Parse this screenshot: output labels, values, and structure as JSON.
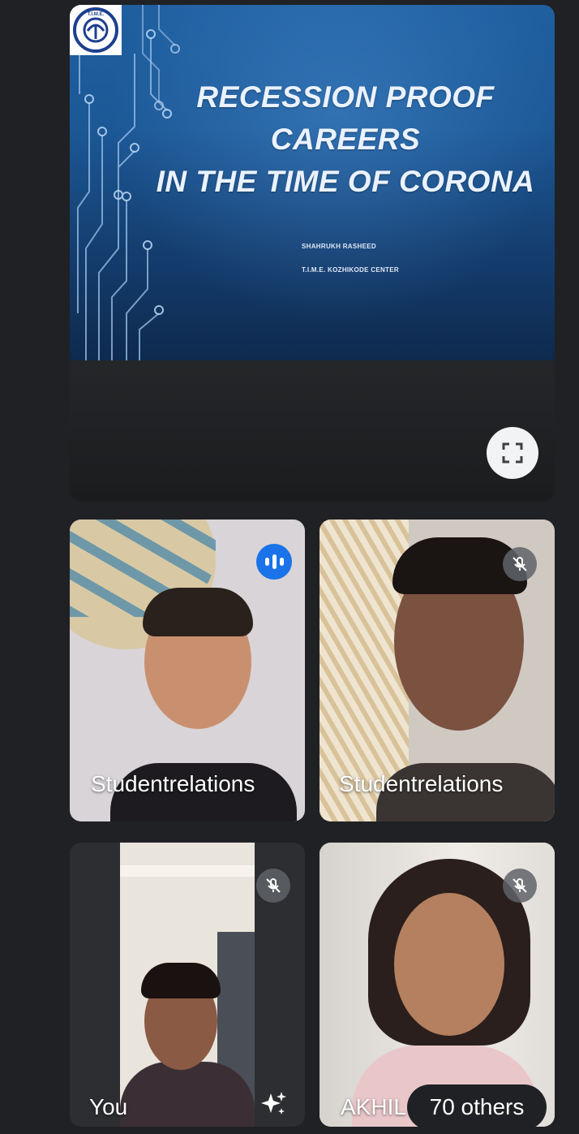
{
  "presentation": {
    "title": "RECESSION PROOF CAREERS IN THE TIME OF CORONA",
    "title_line1": "RECESSION PROOF CAREERS",
    "title_line2": "IN THE TIME OF CORONA",
    "presenter": "SHAHRUKH RASHEED",
    "center": "T.I.M.E. KOZHIKODE CENTER",
    "logo_text": "T.I.M.E.",
    "fullscreen_icon": "fullscreen-icon"
  },
  "tiles": [
    {
      "label": "Studentrelations",
      "status": "speaking",
      "icon": "audio-active-icon"
    },
    {
      "label": "Studentrelations",
      "status": "muted",
      "icon": "mic-off-icon"
    },
    {
      "label": "You",
      "status": "muted",
      "icon": "mic-off-icon",
      "action_icon": "sparkle-effects-icon"
    },
    {
      "label": "AKHIL",
      "status": "muted",
      "icon": "mic-off-icon"
    }
  ],
  "others": {
    "label": "70 others"
  },
  "colors": {
    "background": "#202124",
    "accent": "#1a73e8",
    "slide_blue": "#1f5fa0"
  }
}
